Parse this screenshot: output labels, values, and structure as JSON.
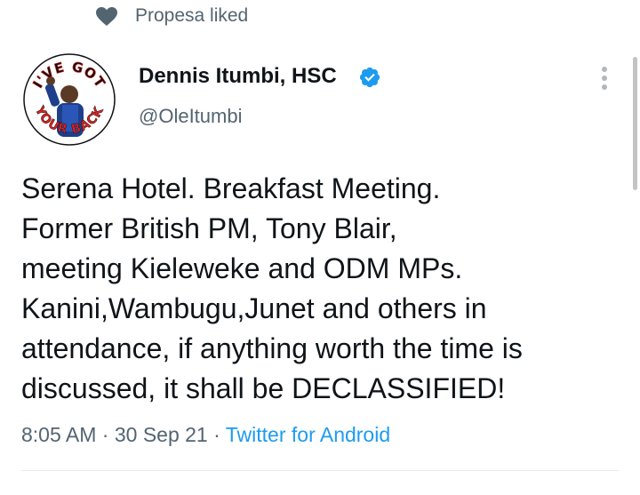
{
  "social_context": {
    "icon": "heart-icon",
    "text": "Propesa liked"
  },
  "author": {
    "avatar_text_top": "I'VE GOT",
    "avatar_text_bottom": "YOUR BACK",
    "name": "Dennis Itumbi, HSC",
    "handle": "@OleItumbi",
    "verified_icon": "verified-badge-icon"
  },
  "tweet": {
    "lines": [
      "Serena Hotel. Breakfast Meeting.",
      "Former British PM, Tony Blair,",
      "meeting Kieleweke and ODM MPs.",
      "Kanini,Wambugu,Junet and others in",
      "attendance, if anything worth the time is",
      "discussed, it shall be DECLASSIFIED!"
    ]
  },
  "meta": {
    "time": "8:05 AM",
    "separator": "·",
    "date": "30 Sep 21",
    "source": "Twitter for Android"
  },
  "colors": {
    "accent": "#1d9bf0",
    "secondary_text": "#536471",
    "primary_text": "#0f1419",
    "avatar_red": "#e0201f"
  }
}
